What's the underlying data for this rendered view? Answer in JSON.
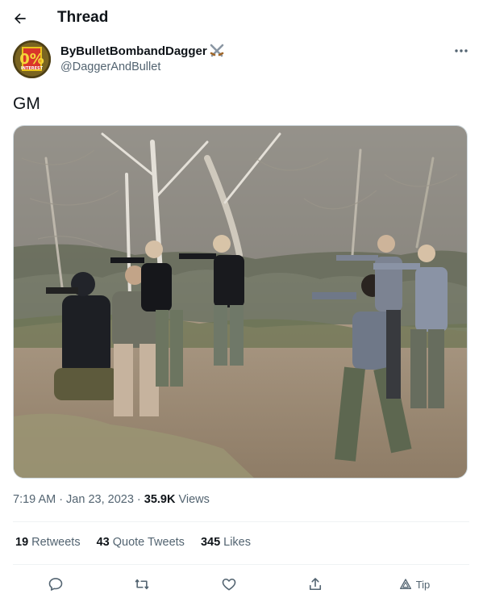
{
  "header": {
    "title": "Thread"
  },
  "author": {
    "display_name": "ByBulletBombandDagger",
    "handle": "@DaggerAndBullet",
    "avatar_text_top": "0%",
    "avatar_text_bottom": "INTEREST"
  },
  "tweet": {
    "text": "GM",
    "time": "7:19 AM",
    "date": "Jan 23, 2023",
    "views_count": "35.9K",
    "views_label": "Views"
  },
  "stats": {
    "retweets_count": "19",
    "retweets_label": "Retweets",
    "quotes_count": "43",
    "quotes_label": "Quote Tweets",
    "likes_count": "345",
    "likes_label": "Likes"
  },
  "actions": {
    "tip_label": "Tip"
  },
  "colors": {
    "text": "#0f1419",
    "secondary": "#536471",
    "divider": "#eff3f4"
  }
}
